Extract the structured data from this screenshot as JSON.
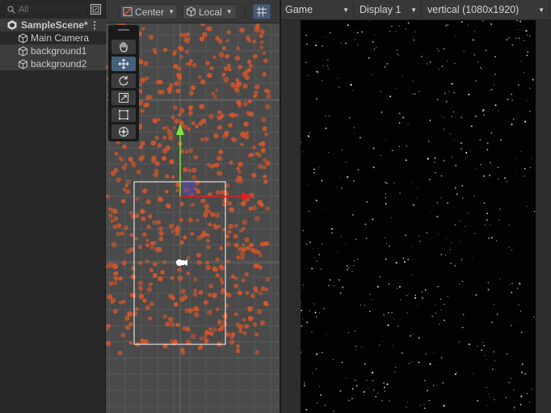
{
  "hierarchy": {
    "search_placeholder": "All",
    "scene": {
      "name": "SampleScene*",
      "icon": "unity-scene-icon"
    },
    "items": [
      {
        "label": "Main Camera",
        "icon": "gameobject-cube-icon",
        "selected": false
      },
      {
        "label": "background1",
        "icon": "gameobject-cube-icon",
        "selected": true
      },
      {
        "label": "background2",
        "icon": "gameobject-cube-icon",
        "selected": true
      }
    ]
  },
  "scene_toolbar": {
    "pivot_label": "Center",
    "space_label": "Local",
    "grid_icon": "grid-snap-icon"
  },
  "tools": [
    "hand-tool-icon",
    "move-tool-icon",
    "rotate-tool-icon",
    "scale-tool-icon",
    "rect-tool-icon",
    "transform-tool-icon"
  ],
  "game_toolbar": {
    "mode_label": "Game",
    "display_label": "Display 1",
    "resolution_label": "vertical (1080x1920)"
  },
  "colors": {
    "particle": "#d9562a",
    "gizmo_y": "#7ee83a",
    "gizmo_x": "#e41f1f",
    "camera_frame": "#ffffff",
    "active_tool": "#46607c"
  }
}
